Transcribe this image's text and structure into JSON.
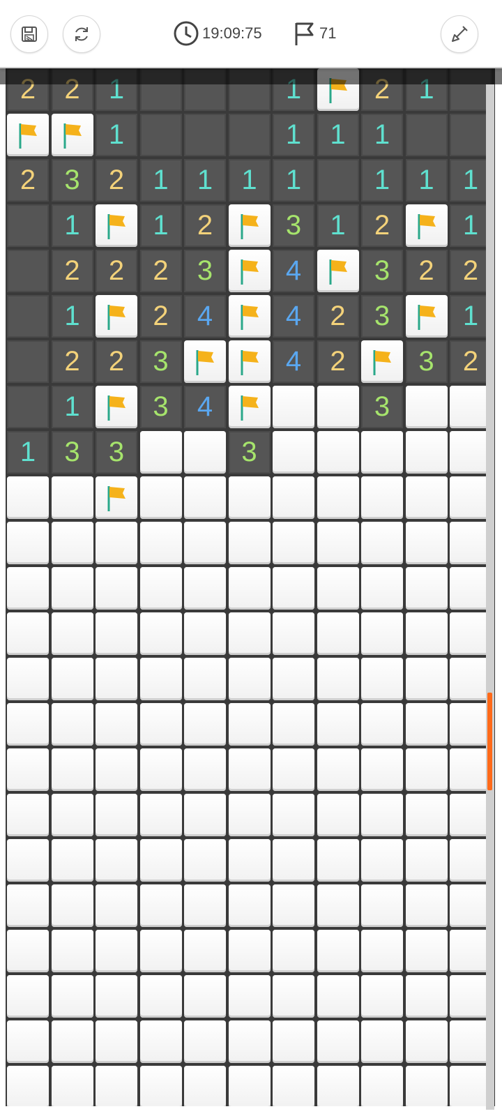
{
  "header": {
    "timer": "19:09:75",
    "flags_remaining": "71",
    "icons": {
      "save": "save-icon",
      "restart": "restart-icon",
      "clock": "clock-icon",
      "flag": "flag-icon",
      "dig": "shovel-icon"
    }
  },
  "colors": {
    "n1": "#5fe0cf",
    "n2": "#f3d27a",
    "n3": "#a6e46c",
    "n4": "#5aa7f0",
    "flag": "#f5b21b",
    "scroll_thumb": "#ff6a1a"
  },
  "board": {
    "columns": 11,
    "visible_rows": [
      "2 2 1 . . . 1 F 2 1 .",
      "F F 1 . . . 1 1 1 . .",
      "2 3 2 1 1 1 1 . 1 1 1",
      ". 1 F 1 2 F 3 1 2 F 1",
      ". 2 2 2 3 F 4 F 3 2 2",
      ". 1 F 2 4 F 4 2 3 F 1",
      ". 2 2 3 F F 4 2 F 3 2",
      ". 1 F 3 4 F # # 3 # #",
      "1 3 3 # # 3 # # # # #",
      "# # F # # # # # # # #",
      "# # # # # # # # # # #",
      "# # # # # # # # # # #",
      "# # # # # # # # # # #",
      "# # # # # # # # # # #",
      "# # # # # # # # # # #",
      "# # # # # # # # # # #",
      "# # # # # # # # # # #",
      "# # # # # # # # # # #",
      "# # # # # # # # # # #",
      "# # # # # # # # # # #",
      "# # # # # # # # # # #",
      "# # # # # # # # # # #",
      "# # # # # # # # # # #"
    ],
    "legend": {
      ".": "revealed-empty",
      "#": "unrevealed",
      "F": "flagged",
      "1-8": "revealed-number"
    }
  }
}
